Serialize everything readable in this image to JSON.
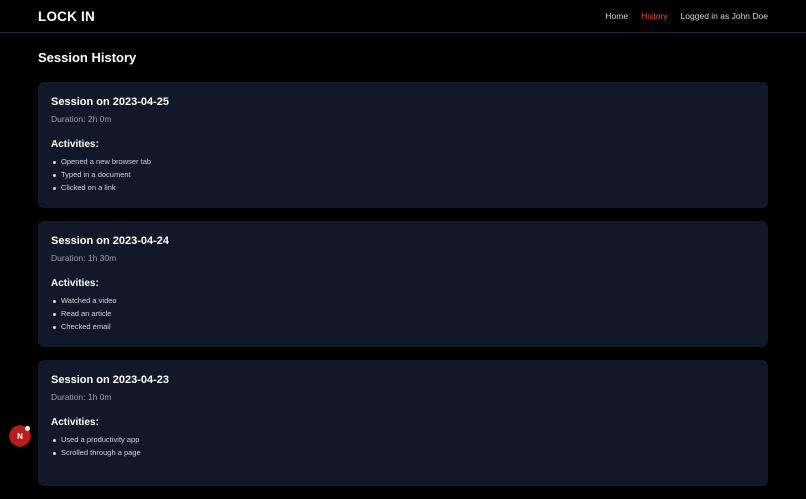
{
  "nav": {
    "brand": "LOCK IN",
    "links": [
      {
        "label": "Home",
        "active": false
      },
      {
        "label": "History",
        "active": true
      }
    ],
    "user_status": "Logged in as John Doe"
  },
  "page": {
    "title": "Session History"
  },
  "activities_heading": "Activities:",
  "sessions": [
    {
      "title": "Session on 2023-04-25",
      "duration": "Duration: 2h 0m",
      "activities": [
        "Opened a new browser tab",
        "Typed in a document",
        "Clicked on a link"
      ]
    },
    {
      "title": "Session on 2023-04-24",
      "duration": "Duration: 1h 30m",
      "activities": [
        "Watched a video",
        "Read an article",
        "Checked email"
      ]
    },
    {
      "title": "Session on 2023-04-23",
      "duration": "Duration: 1h 0m",
      "activities": [
        "Used a productivity app",
        "Scrolled through a page"
      ]
    }
  ],
  "fab": {
    "label": "N",
    "icon": "notification-dot-icon",
    "color": "#b91c1c"
  },
  "colors": {
    "background": "#000000",
    "card": "#111827",
    "accent": "#ef4444",
    "muted_text": "#9ca3af"
  }
}
